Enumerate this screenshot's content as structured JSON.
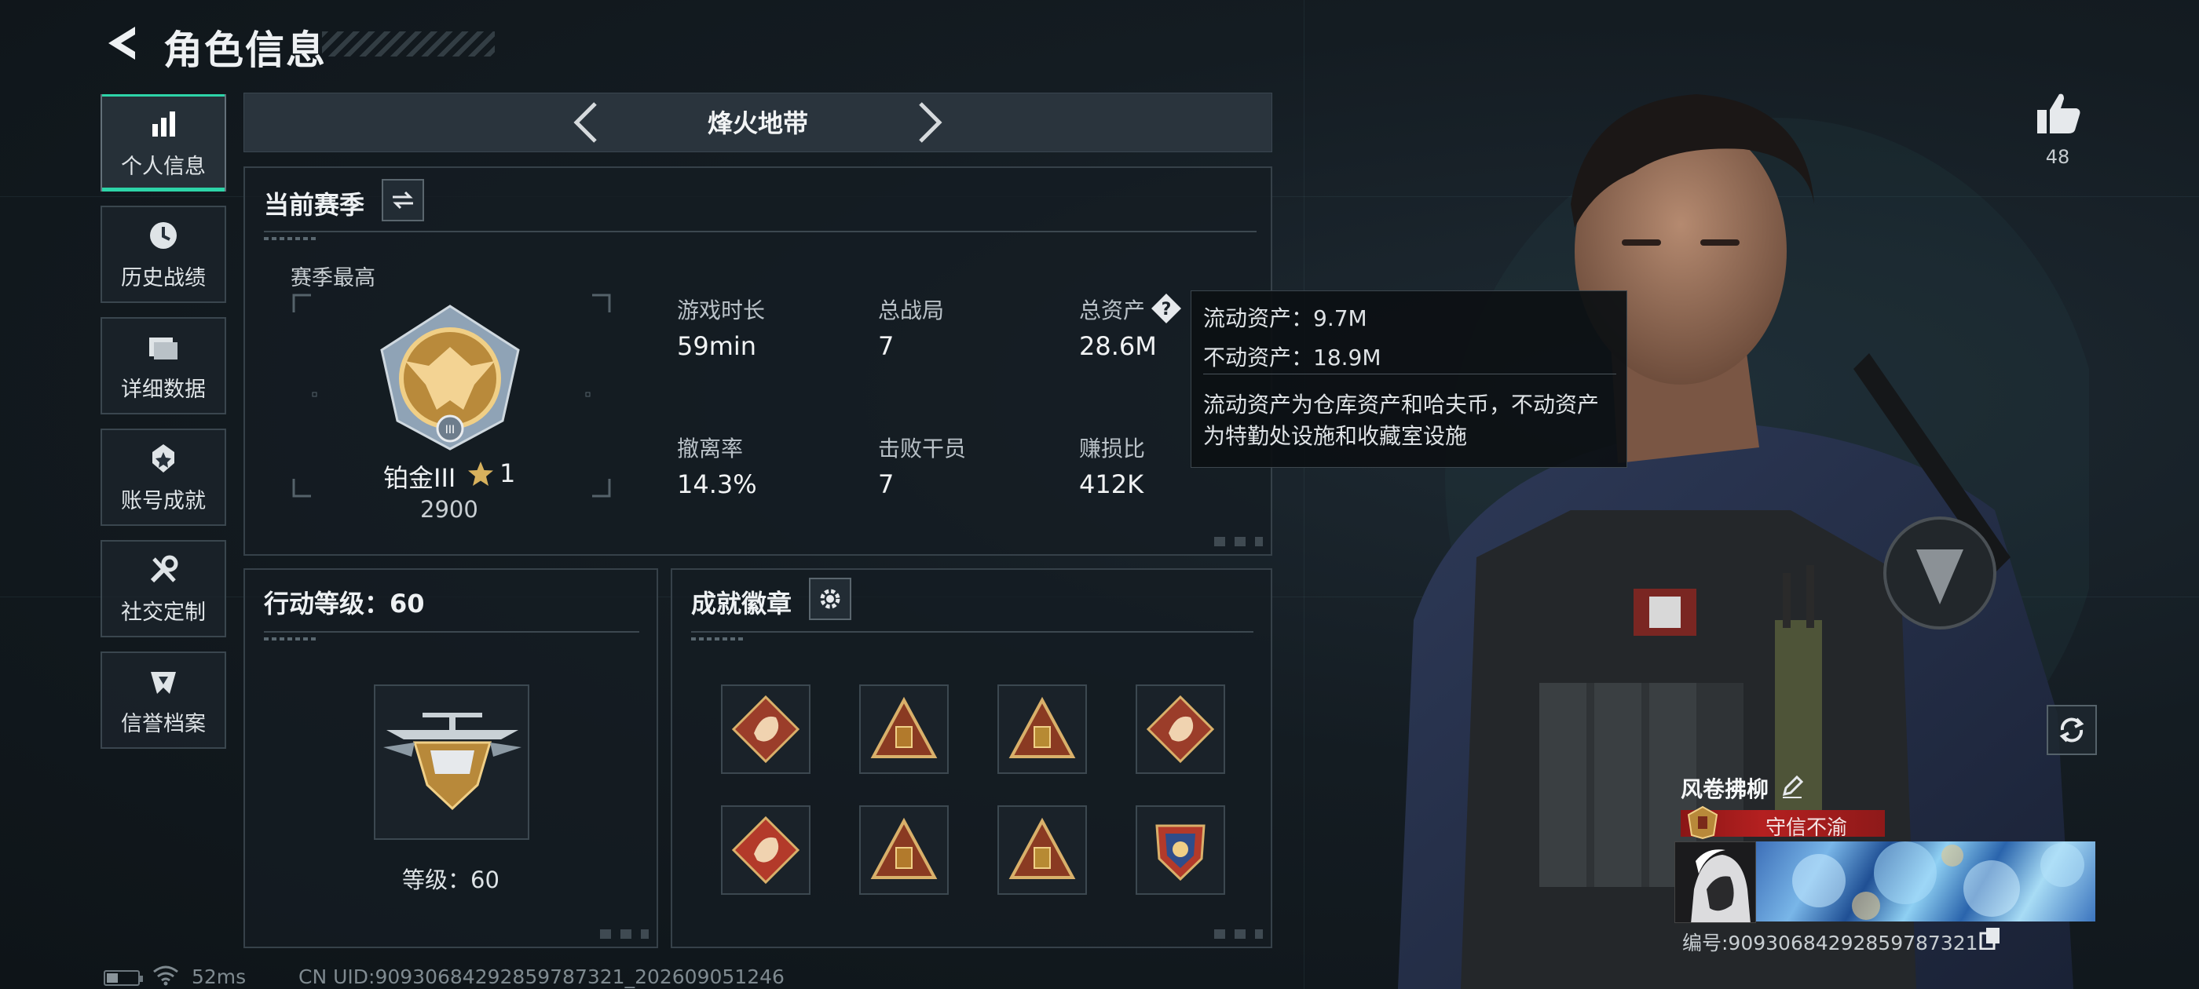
{
  "header": {
    "title": "角色信息"
  },
  "nav": {
    "items": [
      {
        "label": "个人信息",
        "icon": "bar-chart-icon",
        "active": true
      },
      {
        "label": "历史战绩",
        "icon": "clock-icon",
        "active": false
      },
      {
        "label": "详细数据",
        "icon": "folder-icon",
        "active": false
      },
      {
        "label": "账号成就",
        "icon": "achievement-icon",
        "active": false
      },
      {
        "label": "社交定制",
        "icon": "tools-icon",
        "active": false
      },
      {
        "label": "信誉档案",
        "icon": "reputation-icon",
        "active": false
      }
    ]
  },
  "mode": {
    "label": "烽火地带"
  },
  "season": {
    "title": "当前赛季",
    "best_label": "赛季最高",
    "rank_name": "铂金III",
    "rank_stars": "1",
    "rank_score": "2900",
    "stats": [
      {
        "label": "游戏时长",
        "value": "59min"
      },
      {
        "label": "总战局",
        "value": "7"
      },
      {
        "label": "总资产",
        "value": "28.6M"
      },
      {
        "label": "撤离率",
        "value": "14.3%"
      },
      {
        "label": "击败干员",
        "value": "7"
      },
      {
        "label": "赚损比",
        "value": "412K"
      }
    ]
  },
  "tooltip": {
    "liquid": "流动资产：9.7M",
    "fixed": "不动资产：18.9M",
    "desc_line1": "流动资产为仓库资产和哈夫币，不动资产",
    "desc_line2": "为特勤处设施和收藏室设施"
  },
  "action_level": {
    "title": "行动等级：60",
    "level_label": "等级：60"
  },
  "badges": {
    "title": "成就徽章",
    "items": [
      {
        "icon": "dragon-badge-icon",
        "color": "#9b3d2a"
      },
      {
        "icon": "supply-badge-icon",
        "color": "#b27a2c"
      },
      {
        "icon": "lantern-badge-icon",
        "color": "#b78a33"
      },
      {
        "icon": "dragon-badge-icon",
        "color": "#9b3d2a"
      },
      {
        "icon": "star-emblem-badge-icon",
        "color": "#b33a2a"
      },
      {
        "icon": "helmet-badge-icon",
        "color": "#b27a2c"
      },
      {
        "icon": "scroll-badge-icon",
        "color": "#b78a33"
      },
      {
        "icon": "shield-badge-icon",
        "color": "#2f4d8a"
      }
    ]
  },
  "character": {
    "likes": "48",
    "name": "风卷拂柳",
    "title": "守信不渝",
    "player_id": "编号:9093068429285978732​1"
  },
  "footer": {
    "battery_level": 0.35,
    "ping": "52ms",
    "uid": "CN UID:9093068429285978732​1_202609051246"
  },
  "colors": {
    "accent": "#2dd4a8",
    "panel_border": "#364149",
    "title_red": "#b42020"
  }
}
